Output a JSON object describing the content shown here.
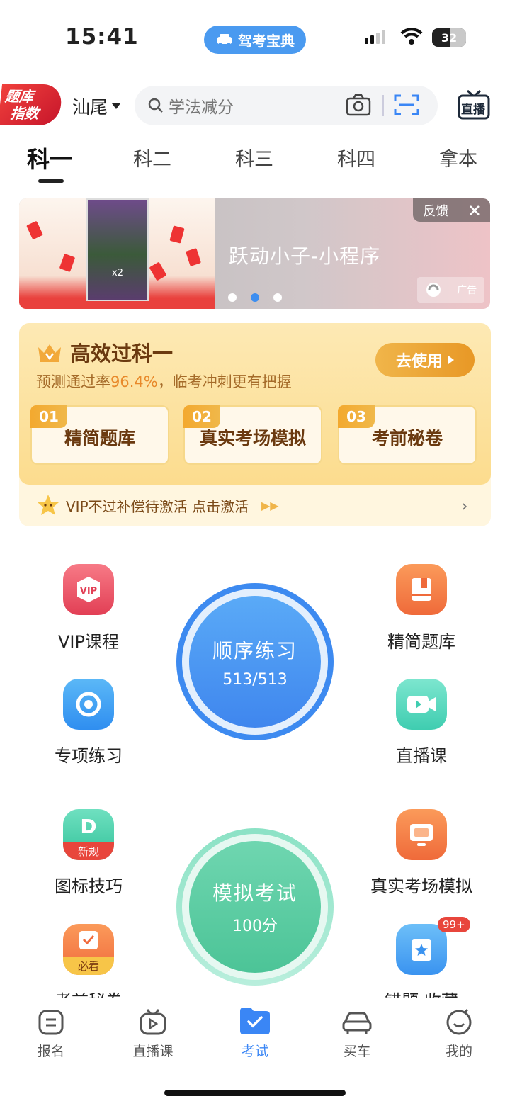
{
  "status": {
    "time": "15:41",
    "app_pill": "驾考宝典",
    "battery": "32"
  },
  "header": {
    "badge_line1": "题库",
    "badge_line2": "指数",
    "city": "汕尾",
    "search_placeholder": "学法减分",
    "live_label": "直播"
  },
  "tabs": [
    {
      "label": "科一"
    },
    {
      "label": "科二"
    },
    {
      "label": "科三"
    },
    {
      "label": "科四"
    },
    {
      "label": "拿本"
    }
  ],
  "banner": {
    "title": "跃动小子-小程序",
    "feedback": "反馈",
    "ad": "广告",
    "game_text": "x2"
  },
  "vip": {
    "title": "高效过科一",
    "subtitle_prefix": "预测通过率",
    "rate": "96.4%",
    "subtitle_suffix": "，临考冲刺更有把握",
    "use_button": "去使用",
    "features": [
      {
        "num": "01",
        "label": "精简题库"
      },
      {
        "num": "02",
        "label": "真实考场模拟"
      },
      {
        "num": "03",
        "label": "考前秘卷"
      }
    ],
    "footer": "VIP不过补偿待激活 点击激活"
  },
  "grid": {
    "vip_course": "VIP课程",
    "simplified_bank": "精简题库",
    "special_practice": "专项练习",
    "live_course": "直播课",
    "icon_tips": "图标技巧",
    "icon_tips_tag": "新规",
    "real_exam_sim": "真实考场模拟",
    "exam_secret": "考前秘卷",
    "exam_secret_tag": "必看",
    "wrong_fav": "错题 收藏",
    "wrong_badge": "99+"
  },
  "sequential": {
    "title": "顺序练习",
    "progress": "513/513"
  },
  "mock": {
    "title": "模拟考试",
    "score": "100分"
  },
  "nav": [
    {
      "label": "报名"
    },
    {
      "label": "直播课"
    },
    {
      "label": "考试"
    },
    {
      "label": "买车"
    },
    {
      "label": "我的"
    }
  ],
  "colors": {
    "accent": "#3a86f5",
    "vip_gold": "#f0b54a",
    "mock_green": "#5fd0a5"
  }
}
